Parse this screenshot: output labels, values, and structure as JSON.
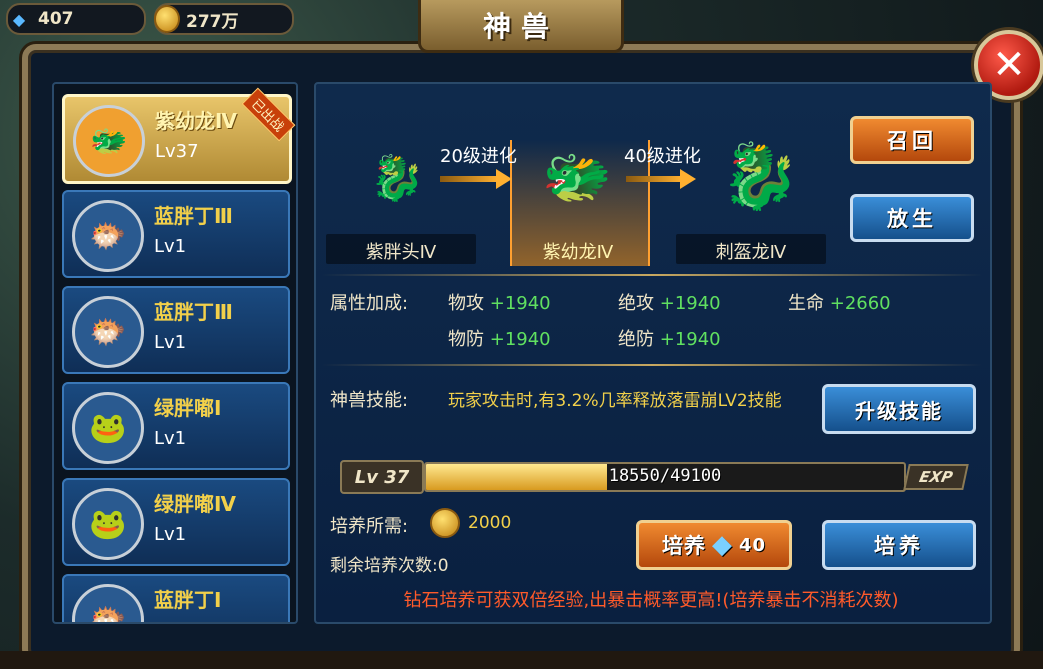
{
  "top": {
    "gems": "407",
    "gold": "277万",
    "title": "神兽"
  },
  "pets": [
    {
      "name": "紫幼龙Ⅳ",
      "level": "Lv37",
      "badge": "已出战",
      "icon": "purple-dragon-icon",
      "selected": true
    },
    {
      "name": "蓝胖丁Ⅲ",
      "level": "Lv1",
      "icon": "blue-blob-icon"
    },
    {
      "name": "蓝胖丁Ⅲ",
      "level": "Lv1",
      "icon": "blue-blob-icon"
    },
    {
      "name": "绿胖嘟Ⅰ",
      "level": "Lv1",
      "icon": "green-horned-icon"
    },
    {
      "name": "绿胖嘟Ⅳ",
      "level": "Lv1",
      "icon": "green-horned-icon"
    },
    {
      "name": "蓝胖丁Ⅰ",
      "level": "",
      "icon": "blue-blob-icon"
    }
  ],
  "evolution": {
    "stages": [
      {
        "name": "紫胖头Ⅳ",
        "icon": "small-purple-dragon-icon"
      },
      {
        "name": "紫幼龙Ⅳ",
        "icon": "young-purple-dragon-icon"
      },
      {
        "name": "刺盔龙Ⅳ",
        "icon": "spiked-dragon-icon"
      }
    ],
    "arrows": [
      "20级进化",
      "40级进化"
    ]
  },
  "buttons": {
    "recall": "召回",
    "release": "放生",
    "upgrade_skill": "升级技能",
    "cultivate_gem": "培养",
    "cultivate_gem_cost": "40",
    "cultivate": "培养"
  },
  "attributes": {
    "label": "属性加成:",
    "items": [
      {
        "name": "物攻",
        "value": "+1940"
      },
      {
        "name": "绝攻",
        "value": "+1940"
      },
      {
        "name": "生命",
        "value": "+2660"
      },
      {
        "name": "物防",
        "value": "+1940"
      },
      {
        "name": "绝防",
        "value": "+1940"
      }
    ]
  },
  "skill": {
    "label": "神兽技能:",
    "text": "玩家攻击时,有3.2%几率释放落雷崩LV2技能"
  },
  "xp": {
    "level_label": "Lv 37",
    "text": "18550/49100",
    "current": 18550,
    "max": 49100,
    "tag": "EXP"
  },
  "cultivate": {
    "cost_label": "培养所需:",
    "cost": "2000",
    "remaining_label": "剩余培养次数:0"
  },
  "notice": "钻石培养可获双倍经验,出暴击概率更高!(培养暴击不消耗次数)",
  "colors": {
    "gold_text": "#f2d04a",
    "green_value": "#60e060",
    "notice_red": "#ff5a2a"
  }
}
